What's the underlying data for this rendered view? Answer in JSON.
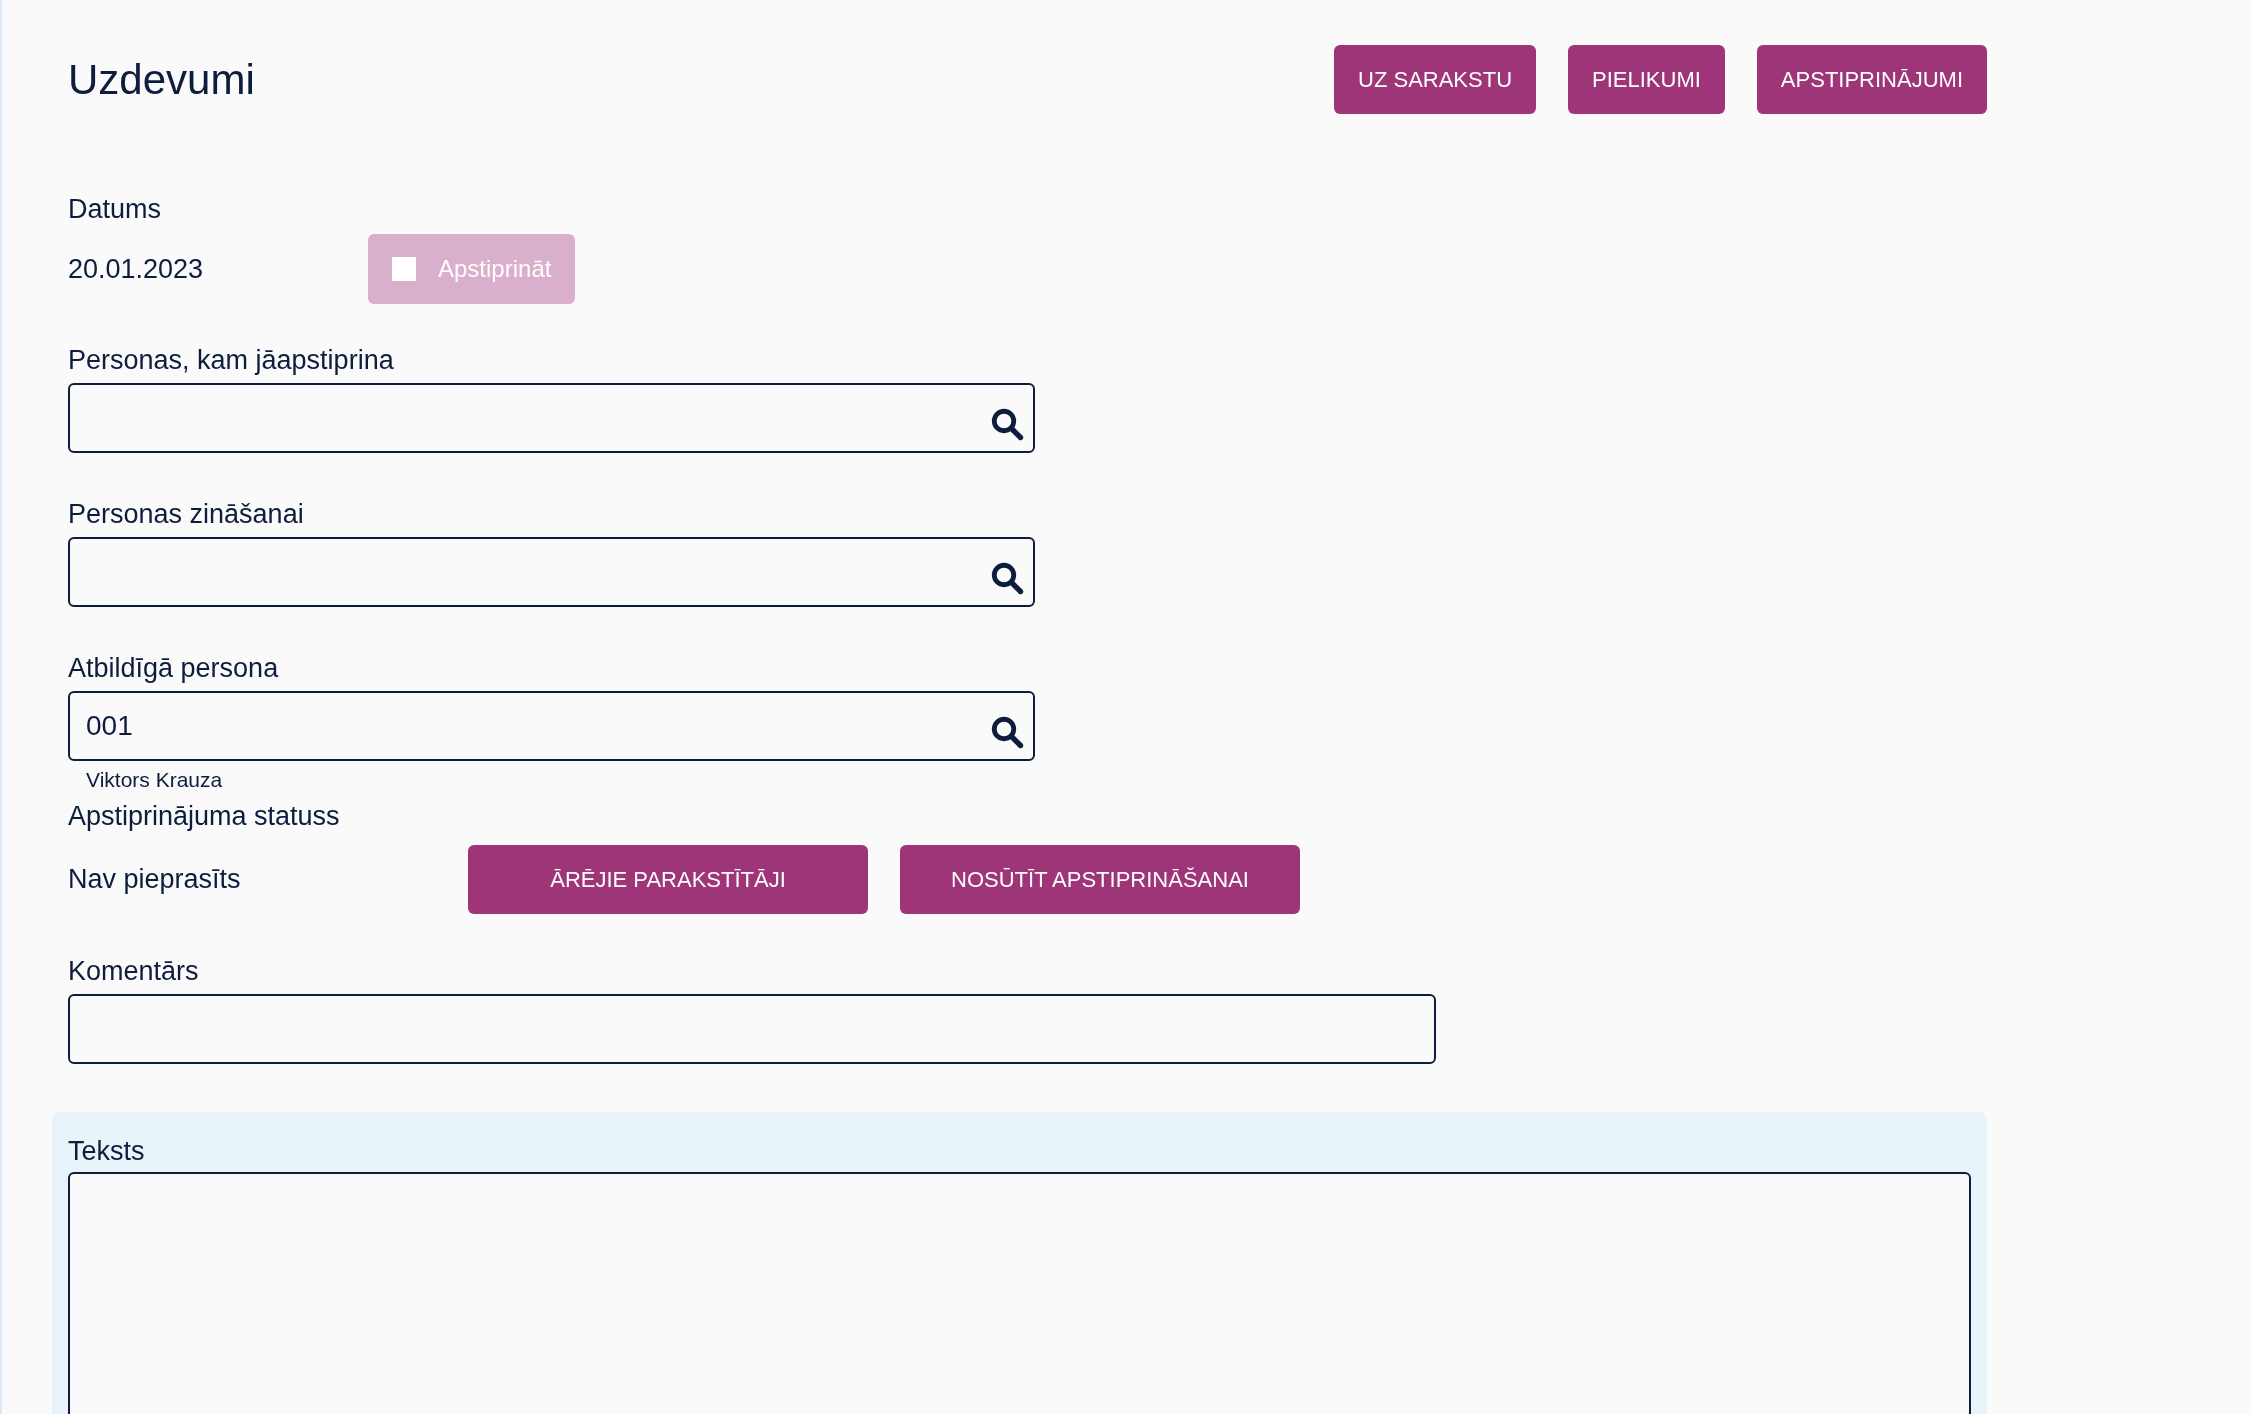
{
  "title": "Uzdevumi",
  "header_buttons": [
    "UZ SARAKSTU",
    "PIELIKUMI",
    "APSTIPRINĀJUMI"
  ],
  "date": {
    "label": "Datums",
    "value": "20.01.2023"
  },
  "approve_button": {
    "label": "Apstiprināt",
    "checked": false,
    "disabled": true
  },
  "lookup_fields": [
    {
      "label": "Personas, kam jāapstiprina"
    },
    {
      "label": "Personas zināšanai"
    },
    {
      "label": "Atbildīgā persona",
      "value": "001",
      "hint": "Viktors Krauza"
    }
  ],
  "approval_status": {
    "label": "Apstiprinājuma statuss",
    "value": "Nav pieprasīts"
  },
  "status_buttons": [
    "ĀRĒJIE PARAKSTĪTĀJI",
    "NOSŪTĪT APSTIPRINĀŠANAI"
  ],
  "comment": {
    "label": "Komentārs"
  },
  "text": {
    "label": "Teksts"
  }
}
